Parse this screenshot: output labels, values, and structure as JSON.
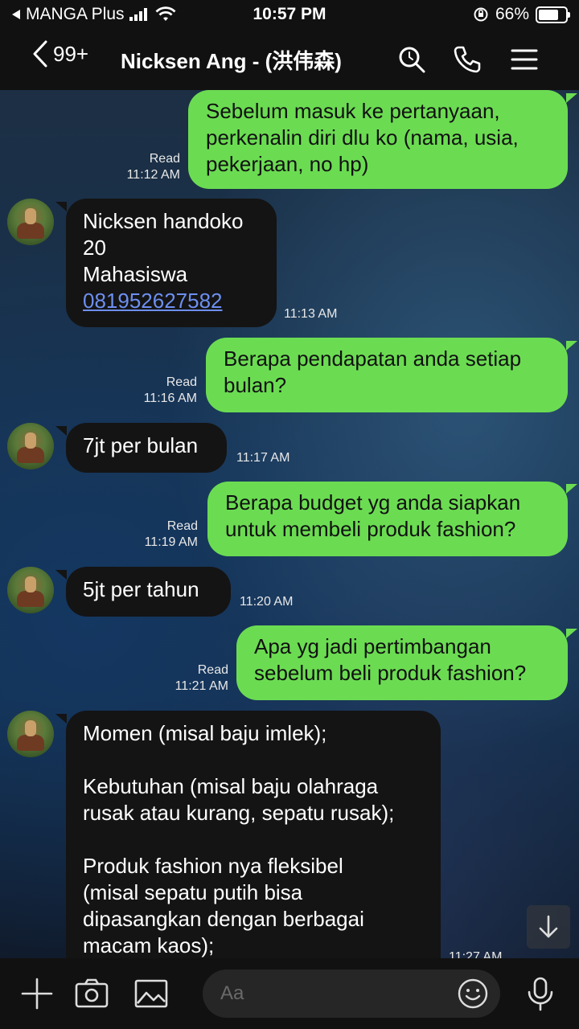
{
  "status_bar": {
    "back_app": "MANGA Plus",
    "time": "10:57 PM",
    "battery_percent": "66%",
    "battery_level": 0.66
  },
  "header": {
    "back_count": "99+",
    "contact_name": "Nicksen Ang - (洪伟森)",
    "icons": [
      "search-icon",
      "phone-icon",
      "menu-icon"
    ]
  },
  "messages": [
    {
      "side": "out",
      "lines": [
        "Sebelum masuk ke pertanyaan,",
        "perkenalin diri dlu ko (nama, usia,",
        "pekerjaan, no hp)"
      ],
      "status": "Read",
      "time": "11:12 AM"
    },
    {
      "side": "in",
      "lines": [
        "Nicksen handoko",
        "20",
        "Mahasiswa"
      ],
      "link": "081952627582",
      "time": "11:13 AM"
    },
    {
      "side": "out",
      "lines": [
        "Berapa pendapatan anda setiap",
        "bulan?"
      ],
      "status": "Read",
      "time": "11:16 AM"
    },
    {
      "side": "in",
      "lines": [
        "7jt per bulan"
      ],
      "time": "11:17 AM"
    },
    {
      "side": "out",
      "lines": [
        "Berapa budget yg anda siapkan",
        "untuk membeli produk fashion?"
      ],
      "status": "Read",
      "time": "11:19 AM"
    },
    {
      "side": "in",
      "lines": [
        "5jt per tahun"
      ],
      "time": "11:20 AM"
    },
    {
      "side": "out",
      "lines": [
        "Apa yg jadi pertimbangan",
        "sebelum beli produk fashion?"
      ],
      "status": "Read",
      "time": "11:21 AM"
    },
    {
      "side": "in",
      "lines": [
        "Momen (misal baju imlek);",
        "",
        "Kebutuhan (misal baju olahraga",
        "rusak atau kurang, sepatu rusak);",
        "",
        "Produk fashion nya fleksibel",
        "(misal sepatu putih bisa",
        "dipasangkan dengan berbagai",
        "macam kaos);"
      ],
      "time": "11:27 AM"
    }
  ],
  "input": {
    "placeholder": "Aa",
    "icons": [
      "plus-icon",
      "camera-icon",
      "image-icon",
      "emoji-icon",
      "microphone-icon"
    ]
  },
  "colors": {
    "outgoing_bubble": "#6bdc52",
    "incoming_bubble": "#141414",
    "link": "#6d8ff0"
  }
}
